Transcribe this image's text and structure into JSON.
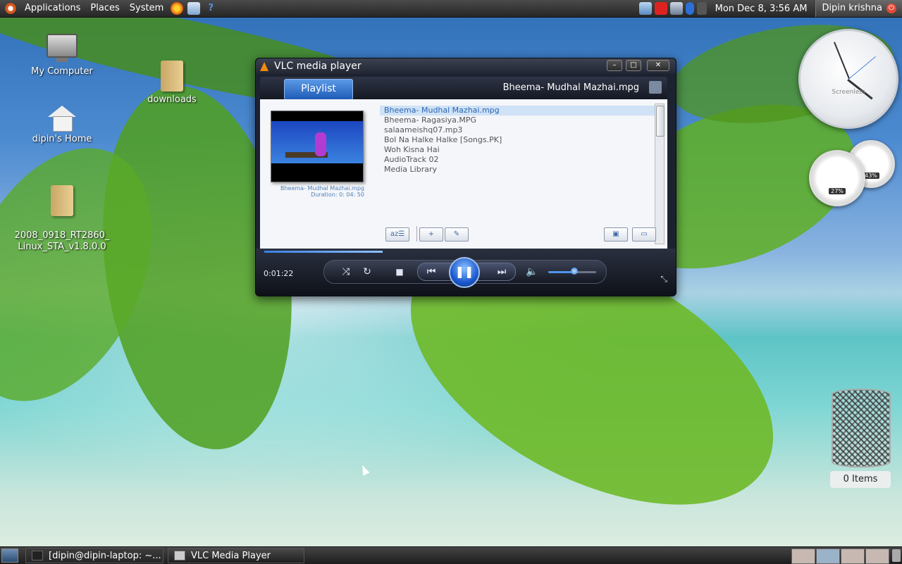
{
  "top_panel": {
    "menus": [
      "Applications",
      "Places",
      "System"
    ],
    "datetime": "Mon Dec  8,  3:56 AM",
    "user": "Dipin krishna"
  },
  "desktop": {
    "icons": [
      {
        "label": "My Computer"
      },
      {
        "label": "downloads"
      },
      {
        "label": "dipin's Home"
      },
      {
        "label": "2008_0918_RT2860_\nLinux_STA_v1.8.0.0"
      }
    ],
    "trash_label": "0 Items"
  },
  "screenlets": {
    "clock_label": "Screenlets",
    "gauge1": "27%",
    "gauge2": "43%"
  },
  "vlc": {
    "window_title": "VLC media player",
    "tab_label": "Playlist",
    "now_playing": "Bheema- Mudhal Mazhai.mpg",
    "thumb_caption_title": "Bheema- Mudhal Mazhai.mpg",
    "thumb_caption_duration": "Duration:  0: 04: 50",
    "playlist": [
      "Bheema- Mudhal Mazhai.mpg",
      "Bheema- Ragasiya.MPG",
      "salaameishq07.mp3",
      "Bol Na Halke Halke [Songs.PK]",
      "Woh Kisna Hai",
      "AudioTrack 02",
      "Media Library"
    ],
    "elapsed": "0:01:22",
    "progress_fraction": 0.3,
    "volume_fraction": 0.55
  },
  "taskbar": {
    "tasks": [
      "[dipin@dipin-laptop: ~...",
      "VLC Media Player"
    ]
  },
  "colors": {
    "accent": "#2b66b4",
    "vlc_dark": "#1d2230"
  }
}
